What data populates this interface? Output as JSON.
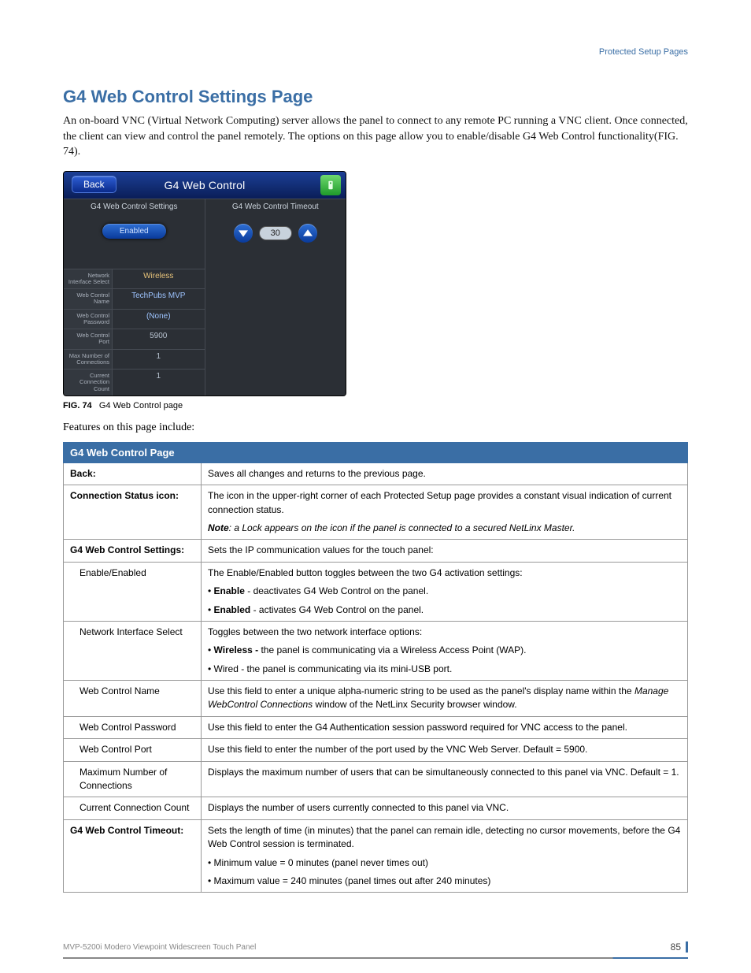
{
  "header_right": "Protected Setup Pages",
  "page_title": "G4 Web Control Settings Page",
  "intro": "An on-board VNC (Virtual Network Computing) server allows the panel to connect to any remote PC running a VNC client. Once connected, the client can view and control the panel remotely. The options on this page allow you to enable/disable G4 Web Control functionality(FIG. 74).",
  "figure": {
    "back_label": "Back",
    "title": "G4 Web Control",
    "left_header": "G4 Web Control Settings",
    "right_header": "G4 Web Control Timeout",
    "enable_btn": "Enabled",
    "timeout_value": "30",
    "rows": [
      {
        "label": "Network Interface Select",
        "value": "Wireless",
        "cls": "wire"
      },
      {
        "label": "Web Control Name",
        "value": "TechPubs MVP",
        "cls": "link"
      },
      {
        "label": "Web Control Password",
        "value": "(None)",
        "cls": "link"
      },
      {
        "label": "Web Control Port",
        "value": "5900",
        "cls": ""
      },
      {
        "label": "Max Number of Connections",
        "value": "1",
        "cls": ""
      },
      {
        "label": "Current Connection Count",
        "value": "1",
        "cls": ""
      }
    ],
    "caption_num": "FIG. 74",
    "caption_text": "G4 Web Control page"
  },
  "features_line": "Features on this page include:",
  "table": {
    "header": "G4 Web Control Page",
    "rows": [
      {
        "label": "Back:",
        "bold": true,
        "desc": [
          "Saves all changes and returns to the previous page."
        ]
      },
      {
        "label": "Connection Status icon:",
        "bold": true,
        "desc": [
          "The icon in the upper-right corner of each Protected Setup page provides a constant visual indication of current connection status.",
          "<span class='b ital'>Note</span><span class='ital'>: a Lock appears on the icon if the panel is connected to a secured NetLinx Master.</span>"
        ]
      },
      {
        "label": "G4 Web Control Settings:",
        "bold": true,
        "desc": [
          "Sets the IP communication values for the touch panel:"
        ]
      },
      {
        "label": "Enable/Enabled",
        "indent": true,
        "desc": [
          "The Enable/Enabled button toggles between the two G4 activation settings:",
          "• <span class='b'>Enable</span> - deactivates G4 Web Control on the panel.",
          "• <span class='b'>Enabled</span> - activates G4 Web Control on the panel."
        ]
      },
      {
        "label": "Network Interface Select",
        "indent": true,
        "desc": [
          "Toggles between the two network interface options:",
          "• <span class='b'>Wireless - </span>the panel is communicating via a Wireless Access Point (WAP).",
          "• Wired - the panel is communicating via its mini-USB port."
        ]
      },
      {
        "label": "Web Control Name",
        "indent": true,
        "desc": [
          "Use this field to enter a unique alpha-numeric string to be used as the panel's display name within the <span class='ital'>Manage WebControl Connections</span> window of the NetLinx Security browser window."
        ]
      },
      {
        "label": "Web Control Password",
        "indent": true,
        "desc": [
          "Use this field to enter the G4 Authentication session password required for VNC access to the panel."
        ]
      },
      {
        "label": "Web Control Port",
        "indent": true,
        "desc": [
          "Use this field to enter the number of the port used by the VNC Web Server. Default = 5900."
        ]
      },
      {
        "label": "Maximum Number of Connections",
        "indent": true,
        "desc": [
          "Displays the maximum number of users that can be simultaneously connected to this panel via VNC. Default = 1."
        ]
      },
      {
        "label": "Current Connection Count",
        "indent": true,
        "desc": [
          "Displays the number of users currently connected to this panel via VNC."
        ]
      },
      {
        "label": "G4 Web Control Timeout:",
        "bold": true,
        "desc": [
          "Sets the length of time (in minutes) that the panel can remain idle, detecting no cursor movements, before the G4 Web Control session is terminated.",
          "• Minimum value = 0 minutes (panel never times out)",
          "• Maximum value = 240 minutes (panel times out after 240 minutes)"
        ]
      }
    ]
  },
  "footer": {
    "product": "MVP-5200i Modero Viewpoint Widescreen Touch Panel",
    "pageno": "85"
  }
}
